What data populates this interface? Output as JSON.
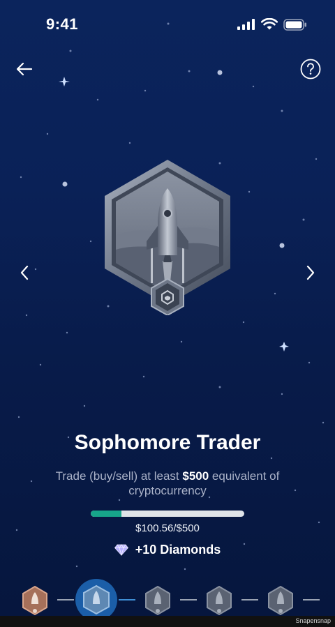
{
  "status_bar": {
    "time": "9:41"
  },
  "badge": {
    "name": "rocket-badge"
  },
  "achievement": {
    "title": "Sophomore Trader",
    "description_prefix": "Trade (buy/sell) at least ",
    "description_amount": "$500",
    "description_suffix": " equivalent of cryptocurrency",
    "progress_current": "$100.56",
    "progress_separator": "/",
    "progress_target": "$500",
    "progress_fraction": 0.2011,
    "reward": "+10 Diamonds"
  },
  "colors": {
    "progress_fill": "#17a58a",
    "background_top": "#0b245c",
    "background_bottom": "#06163d"
  },
  "footer": {
    "watermark": "Snapensnap"
  }
}
